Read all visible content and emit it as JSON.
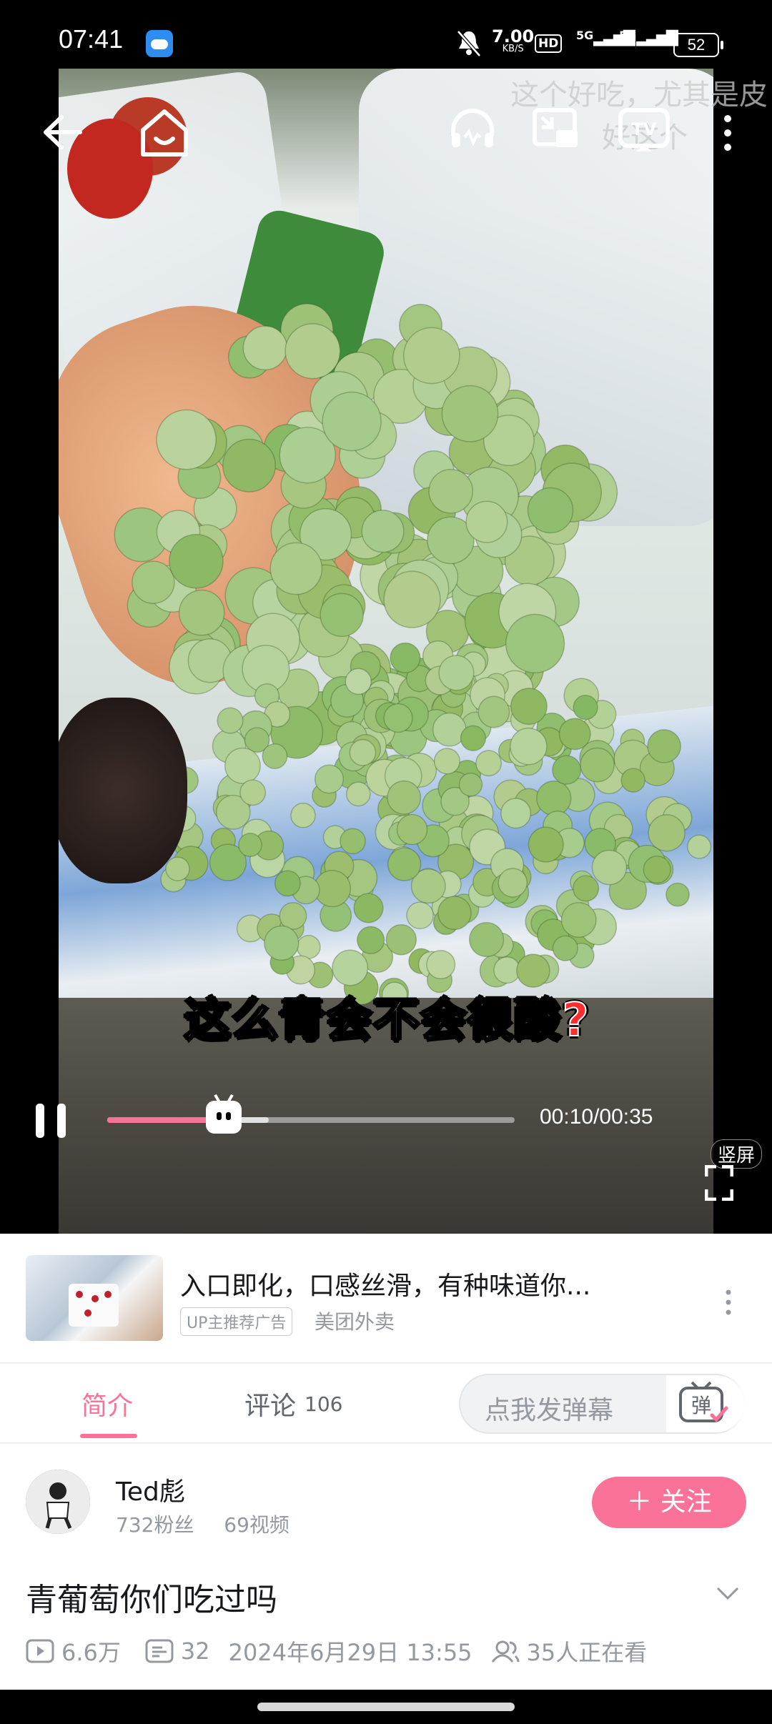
{
  "status_bar": {
    "time": "07:41",
    "net_speed_value": "7.00",
    "net_speed_unit": "KB/S",
    "hd_badge": "HD",
    "signal_1": "5G",
    "signal_2": "5G",
    "battery": "52"
  },
  "player": {
    "subtitle_text": "这么青会不会很酸",
    "subtitle_mark": "?",
    "danmaku": [
      "这个好吃，尤其是皮",
      "好这个"
    ],
    "current_time": "00:10",
    "duration": "00:35",
    "timecode": "00:10/00:35",
    "progress_fraction": 0.286,
    "portrait_label": "竖屏"
  },
  "ad": {
    "title": "入口即化，口感丝滑，有种味道你...",
    "badge": "UP主推荐广告",
    "source": "美团外卖"
  },
  "tabs": {
    "intro": "简介",
    "comments": "评论",
    "comments_count": "106",
    "danmaku_placeholder": "点我发弹幕",
    "danmaku_toggle": "弹"
  },
  "uploader": {
    "name": "Ted彪",
    "fans": "732粉丝",
    "videos": "69视频",
    "follow_label": "＋ 关注"
  },
  "video": {
    "title": "青葡萄你们吃过吗",
    "views": "6.6万",
    "danmaku_count": "32",
    "date": "2024年6月29日 13:55",
    "watching": "35人正在看"
  },
  "colors": {
    "accent": "#fb7299",
    "text_primary": "#18191c",
    "text_secondary": "#9499a0"
  },
  "icons": [
    "back-arrow-icon",
    "home-icon",
    "headphones-icon",
    "pip-icon",
    "tv-cast-icon",
    "more-vertical-icon",
    "pause-icon",
    "fullscreen-icon",
    "play-count-icon",
    "danmaku-count-icon",
    "watching-icon",
    "chevron-down-icon"
  ]
}
